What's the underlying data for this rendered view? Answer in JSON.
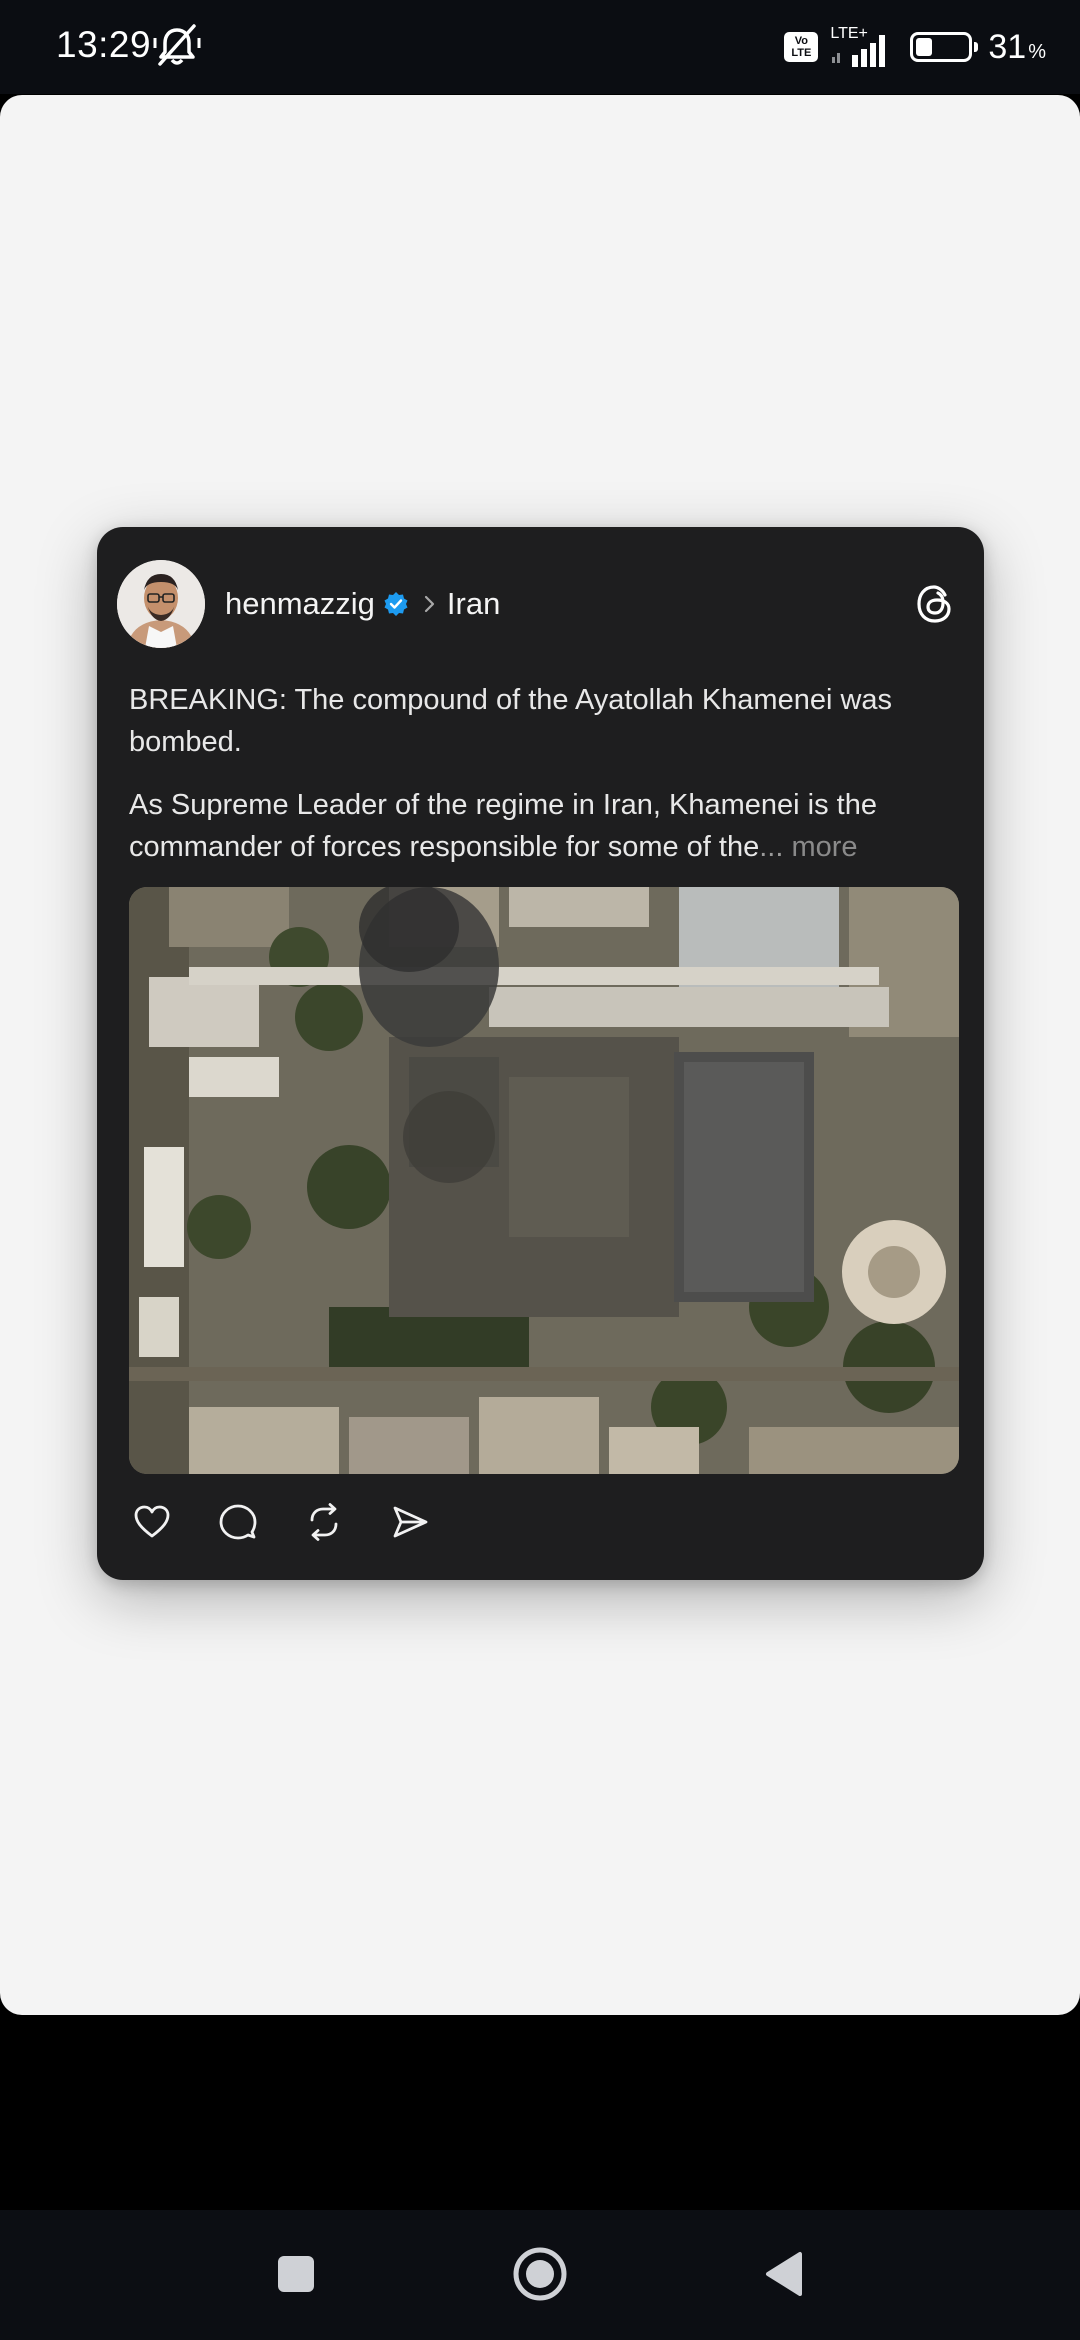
{
  "status_bar": {
    "time": "13:29",
    "volte_top": "Vo",
    "volte_bottom": "LTE",
    "network": "LTE+",
    "battery_percent": "31",
    "battery_unit": "%",
    "battery_level": 0.31,
    "mute_icon": "bell-off-icon"
  },
  "post": {
    "author": "henmazzig",
    "verified": true,
    "topic": "Iran",
    "paragraph_1": "BREAKING: The compound of the Ayatollah Khamenei was bombed.",
    "paragraph_2": "As Supreme Leader of the regime in Iran, Khamenei is the commander of forces responsible for some of the",
    "ellipsis": "...",
    "more_label": "more",
    "image_alt": "Satellite image of a bombed compound"
  },
  "actions": {
    "like": "heart-icon",
    "reply": "comment-icon",
    "repost": "repost-icon",
    "share": "send-icon"
  },
  "nav": {
    "recents": "square-icon",
    "home": "circle-icon",
    "back": "triangle-back-icon"
  },
  "colors": {
    "card_bg": "#1e1e1f",
    "sheet_bg": "#f4f4f4",
    "verified_blue": "#1d9bf0"
  }
}
